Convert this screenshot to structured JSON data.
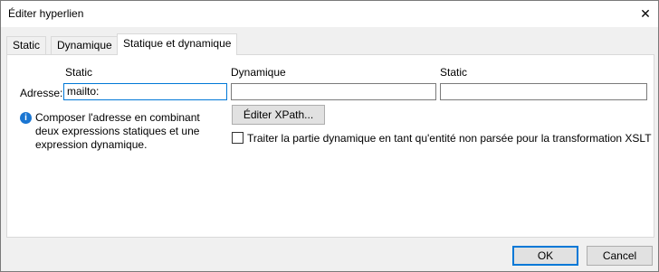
{
  "window": {
    "title": "Éditer hyperlien"
  },
  "tabs": [
    {
      "label": "Static"
    },
    {
      "label": "Dynamique"
    },
    {
      "label": "Statique et dynamique"
    }
  ],
  "columns": {
    "static1": "Static",
    "dynamic": "Dynamique",
    "static2": "Static"
  },
  "address": {
    "label": "Adresse:",
    "static1_value": "mailto:",
    "dynamic_value": "",
    "static2_value": ""
  },
  "info": {
    "text": "Composer l'adresse en combinant deux expressions statiques et une expression dynamique."
  },
  "buttons": {
    "edit_xpath": "Éditer XPath...",
    "ok": "OK",
    "cancel": "Cancel"
  },
  "checkbox": {
    "label": "Traiter la partie dynamique en tant qu'entité non parsée pour la transformation XSLT",
    "checked": false
  }
}
